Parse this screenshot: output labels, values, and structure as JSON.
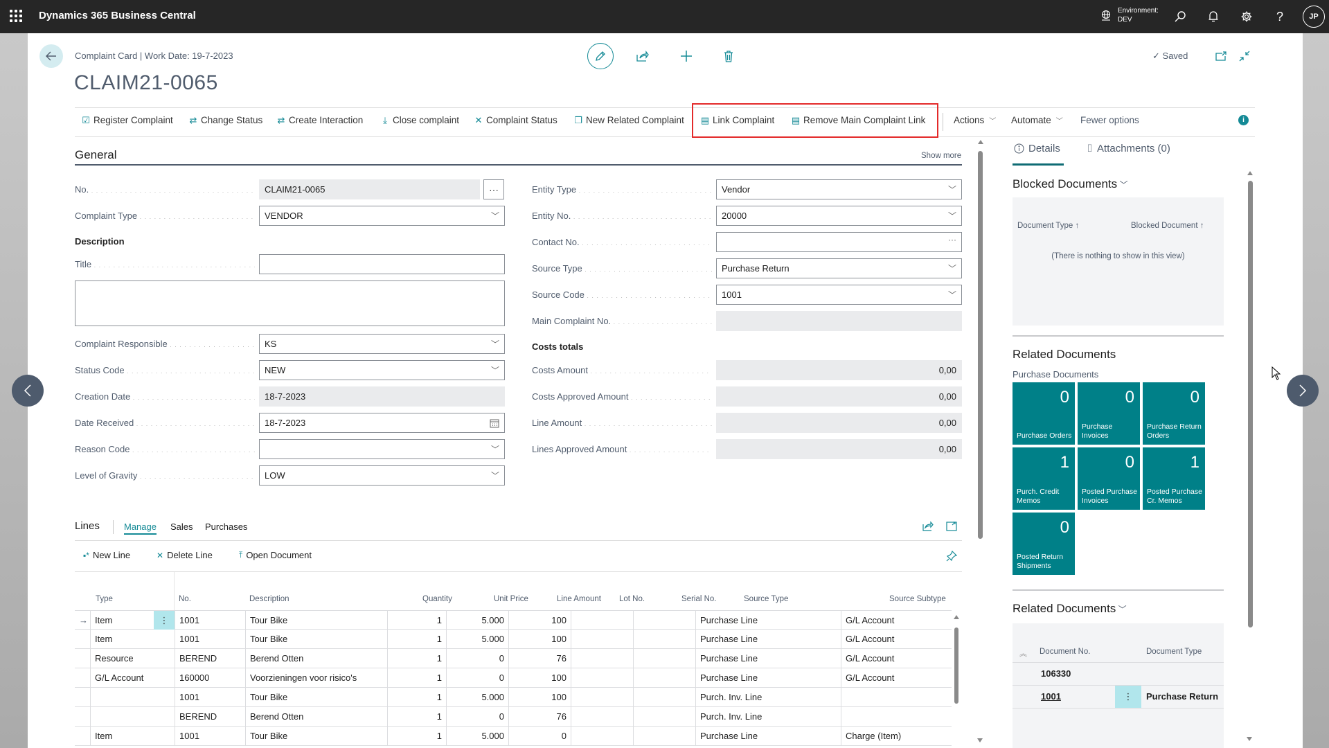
{
  "topbar": {
    "app_title": "Dynamics 365 Business Central",
    "environment_label": "Environment:",
    "environment_value": "DEV",
    "user_initials": "JP"
  },
  "header": {
    "breadcrumb": "Complaint Card | Work Date: 19-7-2023",
    "title": "CLAIM21-0065",
    "saved_label": "Saved"
  },
  "actions": [
    {
      "label": "Register Complaint",
      "icon": "register-icon"
    },
    {
      "label": "Change Status",
      "icon": "change-status-icon"
    },
    {
      "label": "Create Interaction",
      "icon": "create-interaction-icon"
    },
    {
      "label": "Close complaint",
      "icon": "close-complaint-icon"
    },
    {
      "label": "Complaint Status",
      "icon": "complaint-status-icon"
    },
    {
      "label": "New Related Complaint",
      "icon": "new-related-icon"
    },
    {
      "label": "Link Complaint",
      "icon": "link-complaint-icon"
    },
    {
      "label": "Remove Main Complaint Link",
      "icon": "remove-link-icon"
    },
    {
      "label": "Actions",
      "icon": "chevron-down-icon"
    },
    {
      "label": "Automate",
      "icon": "chevron-down-icon"
    },
    {
      "label": "Fewer options",
      "icon": ""
    }
  ],
  "general": {
    "title": "General",
    "show_more": "Show more",
    "left": {
      "no_label": "No.",
      "no_value": "CLAIM21-0065",
      "complaint_type_label": "Complaint Type",
      "complaint_type_value": "VENDOR",
      "description_heading": "Description",
      "title_label": "Title",
      "title_value": "",
      "description_value": "",
      "responsible_label": "Complaint Responsible",
      "responsible_value": "KS",
      "status_label": "Status Code",
      "status_value": "NEW",
      "creation_date_label": "Creation Date",
      "creation_date_value": "18-7-2023",
      "date_received_label": "Date Received",
      "date_received_value": "18-7-2023",
      "reason_code_label": "Reason Code",
      "reason_code_value": "",
      "gravity_label": "Level of Gravity",
      "gravity_value": "LOW"
    },
    "right": {
      "entity_type_label": "Entity Type",
      "entity_type_value": "Vendor",
      "entity_no_label": "Entity No.",
      "entity_no_value": "20000",
      "contact_no_label": "Contact No.",
      "contact_no_value": "",
      "source_type_label": "Source Type",
      "source_type_value": "Purchase Return",
      "source_code_label": "Source Code",
      "source_code_value": "1001",
      "main_complaint_label": "Main Complaint No.",
      "main_complaint_value": "",
      "costs_heading": "Costs totals",
      "costs_amount_label": "Costs Amount",
      "costs_amount_value": "0,00",
      "costs_approved_label": "Costs Approved Amount",
      "costs_approved_value": "0,00",
      "line_amount_label": "Line Amount",
      "line_amount_value": "0,00",
      "lines_approved_label": "Lines Approved Amount",
      "lines_approved_value": "0,00"
    }
  },
  "lines": {
    "title": "Lines",
    "tabs": [
      "Manage",
      "Sales",
      "Purchases"
    ],
    "actions": [
      "New Line",
      "Delete Line",
      "Open Document"
    ],
    "columns": [
      "Type",
      "No.",
      "Description",
      "Quantity",
      "Unit Price",
      "Line Amount",
      "Lot No.",
      "Serial No.",
      "Source Type",
      "Source Subtype"
    ],
    "rows": [
      {
        "type": "Item",
        "no": "1001",
        "description": "Tour Bike",
        "quantity": "1",
        "unit_price": "5.000",
        "line_amount": "100",
        "lot_no": "",
        "serial_no": "",
        "source_type": "Purchase Line",
        "source_subtype": "G/L Account"
      },
      {
        "type": "Item",
        "no": "1001",
        "description": "Tour Bike",
        "quantity": "1",
        "unit_price": "5.000",
        "line_amount": "100",
        "lot_no": "",
        "serial_no": "",
        "source_type": "Purchase Line",
        "source_subtype": "G/L Account"
      },
      {
        "type": "Resource",
        "no": "BEREND",
        "description": "Berend Otten",
        "quantity": "1",
        "unit_price": "0",
        "line_amount": "76",
        "lot_no": "",
        "serial_no": "",
        "source_type": "Purchase Line",
        "source_subtype": "G/L Account"
      },
      {
        "type": "G/L Account",
        "no": "160000",
        "description": "Voorzieningen voor risico's",
        "quantity": "1",
        "unit_price": "0",
        "line_amount": "100",
        "lot_no": "",
        "serial_no": "",
        "source_type": "Purchase Line",
        "source_subtype": "G/L Account"
      },
      {
        "type": "",
        "no": "1001",
        "description": "Tour Bike",
        "quantity": "1",
        "unit_price": "5.000",
        "line_amount": "100",
        "lot_no": "",
        "serial_no": "",
        "source_type": "Purch. Inv. Line",
        "source_subtype": ""
      },
      {
        "type": "",
        "no": "BEREND",
        "description": "Berend Otten",
        "quantity": "1",
        "unit_price": "0",
        "line_amount": "76",
        "lot_no": "",
        "serial_no": "",
        "source_type": "Purch. Inv. Line",
        "source_subtype": ""
      },
      {
        "type": "Item",
        "no": "1001",
        "description": "Tour Bike",
        "quantity": "1",
        "unit_price": "5.000",
        "line_amount": "0",
        "lot_no": "",
        "serial_no": "",
        "source_type": "Purchase Line",
        "source_subtype": "Charge (Item)"
      }
    ]
  },
  "factbox": {
    "tabs": [
      "Details",
      "Attachments (0)"
    ],
    "blocked": {
      "title": "Blocked Documents",
      "columns": [
        "Document Type ↑",
        "Blocked Document ↑"
      ],
      "empty_text": "(There is nothing to show in this view)"
    },
    "related_tiles": {
      "title": "Related Documents",
      "subtitle": "Purchase Documents",
      "tiles": [
        {
          "count": "0",
          "label": "Purchase Orders"
        },
        {
          "count": "0",
          "label": "Purchase Invoices"
        },
        {
          "count": "0",
          "label": "Purchase Return Orders"
        },
        {
          "count": "1",
          "label": "Purch. Credit Memos"
        },
        {
          "count": "0",
          "label": "Posted Purchase Invoices"
        },
        {
          "count": "1",
          "label": "Posted Purchase Cr. Memos"
        },
        {
          "count": "0",
          "label": "Posted Return Shipments"
        }
      ]
    },
    "related_list": {
      "title": "Related Documents",
      "columns": [
        "Document No.",
        "Document Type"
      ],
      "rows": [
        {
          "document_no": "106330",
          "document_type": ""
        },
        {
          "document_no": "1001",
          "document_type": "Purchase Return"
        }
      ]
    }
  },
  "colors": {
    "accent": "#148a96",
    "tile": "#008088",
    "topbar": "#262626",
    "highlight": "#e32a2a"
  }
}
